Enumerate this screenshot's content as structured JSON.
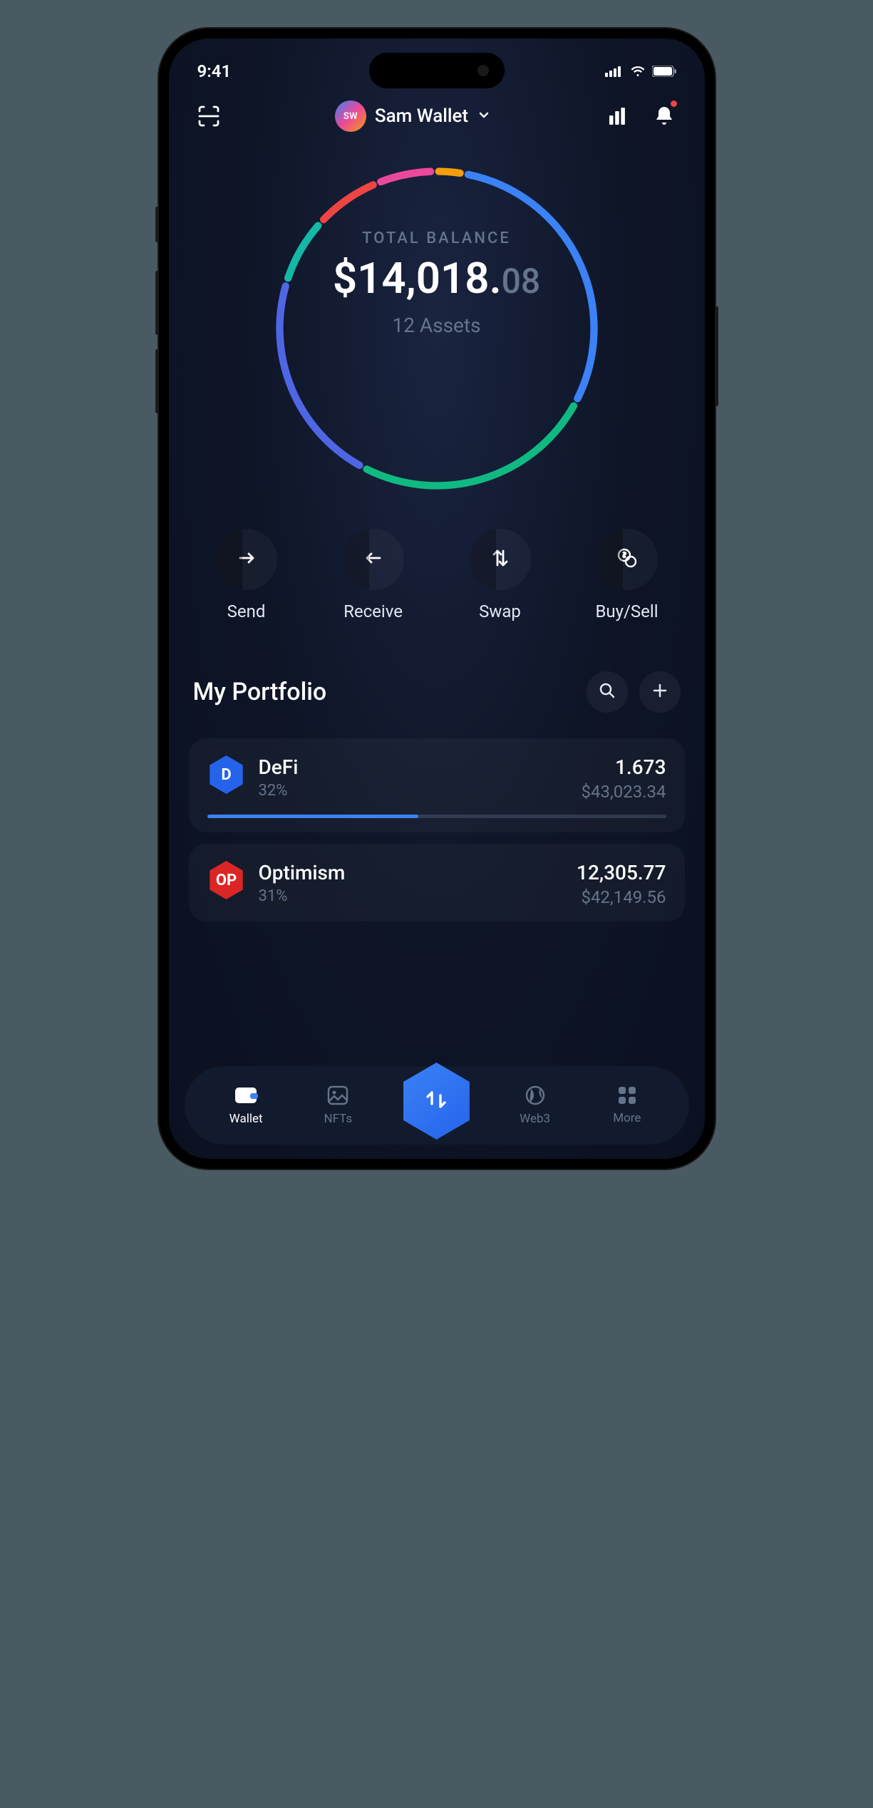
{
  "status": {
    "time": "9:41"
  },
  "header": {
    "avatar_initials": "SW",
    "wallet_name": "Sam Wallet"
  },
  "balance": {
    "label": "TOTAL BALANCE",
    "amount_main": "$14,018.",
    "amount_cents": "08",
    "assets_count": "12 Assets"
  },
  "actions": {
    "send": "Send",
    "receive": "Receive",
    "swap": "Swap",
    "buysell": "Buy/Sell"
  },
  "portfolio": {
    "title": "My Portfolio",
    "items": [
      {
        "name": "DeFi",
        "pct": "32%",
        "amount": "1.673",
        "usd": "$43,023.34",
        "icon_bg": "#2563eb",
        "icon_text": "D",
        "progress": 46
      },
      {
        "name": "Optimism",
        "pct": "31%",
        "amount": "12,305.77",
        "usd": "$42,149.56",
        "icon_bg": "#dc2626",
        "icon_text": "OP",
        "progress": 0
      }
    ]
  },
  "tabs": {
    "wallet": "Wallet",
    "nfts": "NFTs",
    "web3": "Web3",
    "more": "More"
  },
  "chart_data": {
    "type": "pie",
    "title": "TOTAL BALANCE",
    "series": [
      {
        "name": "blue",
        "pct": 30,
        "color": "#3b82f6"
      },
      {
        "name": "green",
        "pct": 25,
        "color": "#10b981"
      },
      {
        "name": "indigo",
        "pct": 22,
        "color": "#4f66e4"
      },
      {
        "name": "teal",
        "pct": 7,
        "color": "#14b8a6"
      },
      {
        "name": "red",
        "pct": 7,
        "color": "#ef4444"
      },
      {
        "name": "pink",
        "pct": 6,
        "color": "#ec4899"
      },
      {
        "name": "orange",
        "pct": 3,
        "color": "#f59e0b"
      }
    ]
  }
}
